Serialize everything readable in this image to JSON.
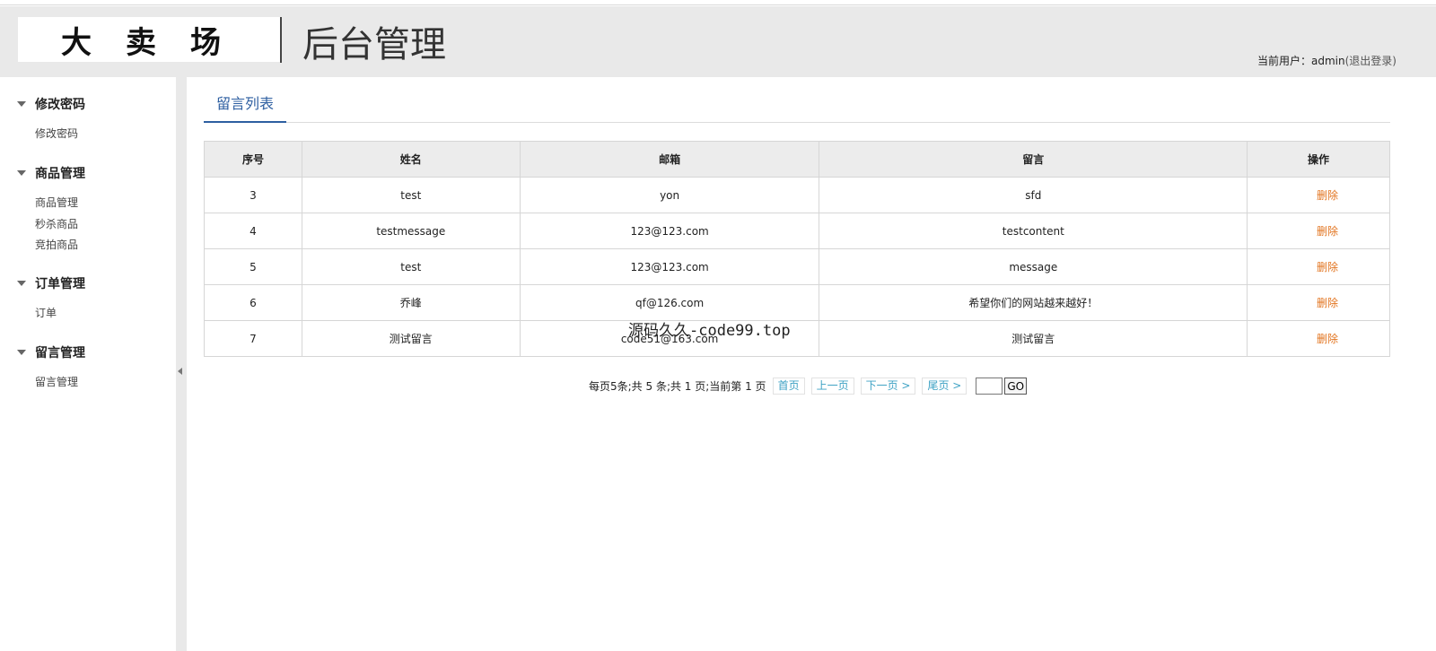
{
  "header": {
    "logo": "大卖场",
    "title": "后台管理",
    "user_label": "当前用户：",
    "username": "admin",
    "logout": "(退出登录)"
  },
  "sidebar": {
    "groups": [
      {
        "label": "修改密码",
        "items": [
          "修改密码"
        ]
      },
      {
        "label": "商品管理",
        "items": [
          "商品管理",
          "秒杀商品",
          "竞拍商品"
        ]
      },
      {
        "label": "订单管理",
        "items": [
          "订单"
        ]
      },
      {
        "label": "留言管理",
        "items": [
          "留言管理"
        ]
      }
    ]
  },
  "main": {
    "tab": "留言列表",
    "table": {
      "headers": [
        "序号",
        "姓名",
        "邮箱",
        "留言",
        "操作"
      ],
      "rows": [
        [
          "3",
          "test",
          "yon",
          "sfd",
          "删除"
        ],
        [
          "4",
          "testmessage",
          "123@123.com",
          "testcontent",
          "删除"
        ],
        [
          "5",
          "test",
          "123@123.com",
          "message",
          "删除"
        ],
        [
          "6",
          "乔峰",
          "qf@126.com",
          "希望你们的网站越来越好！",
          "删除"
        ],
        [
          "7",
          "测试留言",
          "code51@163.com",
          "测试留言",
          "删除"
        ]
      ]
    },
    "pager": {
      "summary": "每页5条;共 5 条;共 1 页;当前第 1 页",
      "first": "首页",
      "prev": "上一页",
      "next": "下一页 >",
      "last": "尾页 >",
      "go": "GO"
    }
  },
  "watermark": "源码久久-code99.top"
}
